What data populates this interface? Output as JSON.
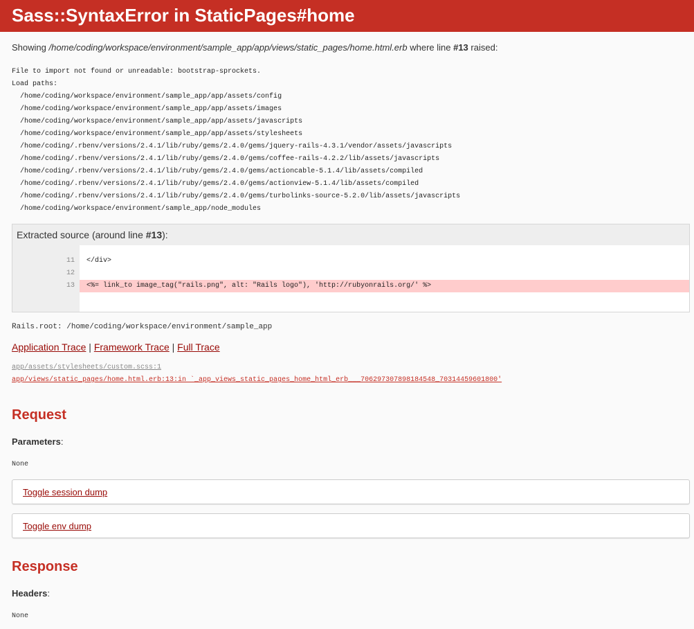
{
  "header": {
    "title": "Sass::SyntaxError in StaticPages#home"
  },
  "showing": {
    "prefix": "Showing ",
    "path": "/home/coding/workspace/environment/sample_app/app/views/static_pages/home.html.erb",
    "middle": " where line ",
    "line": "#13",
    "suffix": " raised:"
  },
  "error_message": "File to import not found or unreadable: bootstrap-sprockets.\nLoad paths:\n  /home/coding/workspace/environment/sample_app/app/assets/config\n  /home/coding/workspace/environment/sample_app/app/assets/images\n  /home/coding/workspace/environment/sample_app/app/assets/javascripts\n  /home/coding/workspace/environment/sample_app/app/assets/stylesheets\n  /home/coding/.rbenv/versions/2.4.1/lib/ruby/gems/2.4.0/gems/jquery-rails-4.3.1/vendor/assets/javascripts\n  /home/coding/.rbenv/versions/2.4.1/lib/ruby/gems/2.4.0/gems/coffee-rails-4.2.2/lib/assets/javascripts\n  /home/coding/.rbenv/versions/2.4.1/lib/ruby/gems/2.4.0/gems/actioncable-5.1.4/lib/assets/compiled\n  /home/coding/.rbenv/versions/2.4.1/lib/ruby/gems/2.4.0/gems/actionview-5.1.4/lib/assets/compiled\n  /home/coding/.rbenv/versions/2.4.1/lib/ruby/gems/2.4.0/gems/turbolinks-source-5.2.0/lib/assets/javascripts\n  /home/coding/workspace/environment/sample_app/node_modules",
  "source": {
    "title_prefix": "Extracted source (around line ",
    "title_line": "#13",
    "title_suffix": "):",
    "lines": [
      {
        "num": "11",
        "code": "</div>"
      },
      {
        "num": "12",
        "code": ""
      },
      {
        "num": "13",
        "code": "<%= link_to image_tag(\"rails.png\", alt: \"Rails logo\"), 'http://rubyonrails.org/' %>"
      }
    ]
  },
  "rails_root": "Rails.root: /home/coding/workspace/environment/sample_app",
  "trace": {
    "links": [
      "Application Trace",
      "Framework Trace",
      "Full Trace"
    ],
    "separator": " | ",
    "lines": [
      "app/assets/stylesheets/custom.scss:1",
      "app/views/static_pages/home.html.erb:13:in `_app_views_static_pages_home_html_erb___706297307898184548_70314459601800'"
    ]
  },
  "request": {
    "heading": "Request",
    "params_label": "Parameters",
    "colon": ":",
    "params_value": "None",
    "toggle_session": "Toggle session dump",
    "toggle_env": "Toggle env dump"
  },
  "response": {
    "heading": "Response",
    "headers_label": "Headers",
    "colon": ":",
    "headers_value": "None"
  },
  "colors": {
    "header_bg": "#c52f24",
    "link": "#980905",
    "highlight": "#ffcccc"
  }
}
